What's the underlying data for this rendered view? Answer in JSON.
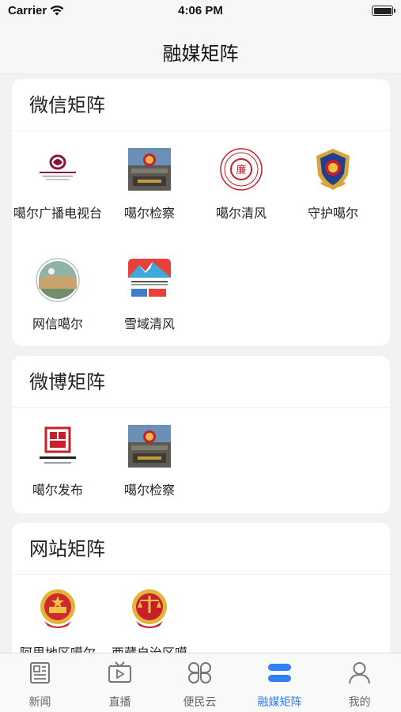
{
  "status_bar": {
    "carrier": "Carrier",
    "time": "4:06 PM"
  },
  "nav": {
    "title": "融媒矩阵"
  },
  "sections": [
    {
      "title": "微信矩阵",
      "items": [
        {
          "label": "噶尔广播电视台",
          "icon": "tv-station-logo"
        },
        {
          "label": "噶尔检察",
          "icon": "procuratorate-building-photo"
        },
        {
          "label": "噶尔清风",
          "icon": "clean-wind-seal-logo"
        },
        {
          "label": "守护噶尔",
          "icon": "police-badge"
        },
        {
          "label": "网信噶尔",
          "icon": "landscape-circle-logo"
        },
        {
          "label": "雪域清风",
          "icon": "snow-mountain-logo"
        }
      ]
    },
    {
      "title": "微博矩阵",
      "items": [
        {
          "label": "噶尔发布",
          "icon": "red-seal-logo"
        },
        {
          "label": "噶尔检察",
          "icon": "procuratorate-building-photo"
        }
      ]
    },
    {
      "title": "网站矩阵",
      "items": [
        {
          "label": "阿里地区噶尔",
          "icon": "national-emblem"
        },
        {
          "label": "西藏自治区噶",
          "icon": "court-emblem"
        }
      ]
    }
  ],
  "tabs": [
    {
      "label": "新闻",
      "icon": "news-icon",
      "active": false
    },
    {
      "label": "直播",
      "icon": "live-tv-icon",
      "active": false
    },
    {
      "label": "便民云",
      "icon": "services-grid-icon",
      "active": false
    },
    {
      "label": "融媒矩阵",
      "icon": "media-matrix-icon",
      "active": true
    },
    {
      "label": "我的",
      "icon": "user-icon",
      "active": false
    }
  ],
  "colors": {
    "accent": "#2f7ff5",
    "background": "#f2f2f5",
    "card": "#ffffff"
  }
}
